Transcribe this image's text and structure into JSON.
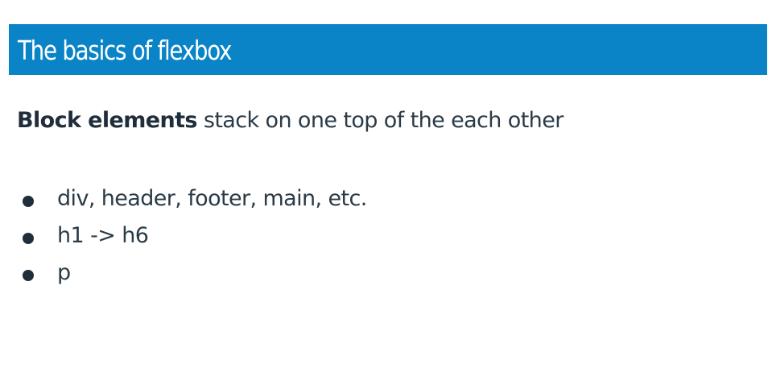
{
  "slide": {
    "title": "The basics of flexbox",
    "lead": {
      "bold": "Block elements",
      "rest": " stack on one top of the each other"
    },
    "bullets": [
      "div, header, footer, main, etc.",
      "h1 -> h6",
      "p"
    ]
  },
  "colors": {
    "title_bar": "#0a84c6",
    "title_text": "#ffffff",
    "body_text": "#2a3b47"
  }
}
